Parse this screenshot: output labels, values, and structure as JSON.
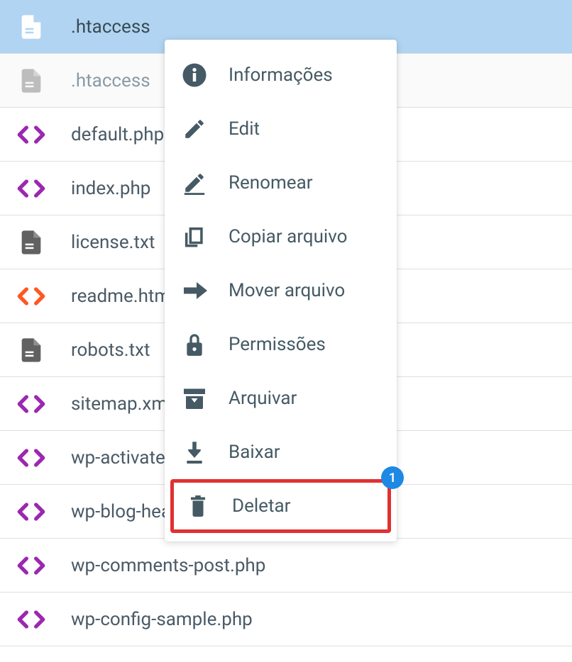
{
  "files": [
    {
      "name": ".htaccess",
      "icon": "doc-white",
      "state": "selected"
    },
    {
      "name": ".htaccess",
      "icon": "doc-gray",
      "state": "disabled"
    },
    {
      "name": "default.php",
      "icon": "code-purple",
      "state": "normal"
    },
    {
      "name": "index.php",
      "icon": "code-purple",
      "state": "normal"
    },
    {
      "name": "license.txt",
      "icon": "doc-dark",
      "state": "normal"
    },
    {
      "name": "readme.html",
      "icon": "code-orange",
      "state": "normal"
    },
    {
      "name": "robots.txt",
      "icon": "doc-dark",
      "state": "normal"
    },
    {
      "name": "sitemap.xml",
      "icon": "code-purple",
      "state": "normal"
    },
    {
      "name": "wp-activate.php",
      "icon": "code-purple",
      "state": "normal"
    },
    {
      "name": "wp-blog-header.php",
      "icon": "code-purple",
      "state": "normal"
    },
    {
      "name": "wp-comments-post.php",
      "icon": "code-purple",
      "state": "normal"
    },
    {
      "name": "wp-config-sample.php",
      "icon": "code-purple",
      "state": "normal"
    }
  ],
  "menu": [
    {
      "label": "Informações",
      "icon": "info"
    },
    {
      "label": "Edit",
      "icon": "pencil"
    },
    {
      "label": "Renomear",
      "icon": "pencil-line"
    },
    {
      "label": "Copiar arquivo",
      "icon": "copy"
    },
    {
      "label": "Mover arquivo",
      "icon": "arrow-right"
    },
    {
      "label": "Permissões",
      "icon": "lock"
    },
    {
      "label": "Arquivar",
      "icon": "archive"
    },
    {
      "label": "Baixar",
      "icon": "download"
    },
    {
      "label": "Deletar",
      "icon": "trash",
      "highlighted": true
    }
  ],
  "badge": "1"
}
